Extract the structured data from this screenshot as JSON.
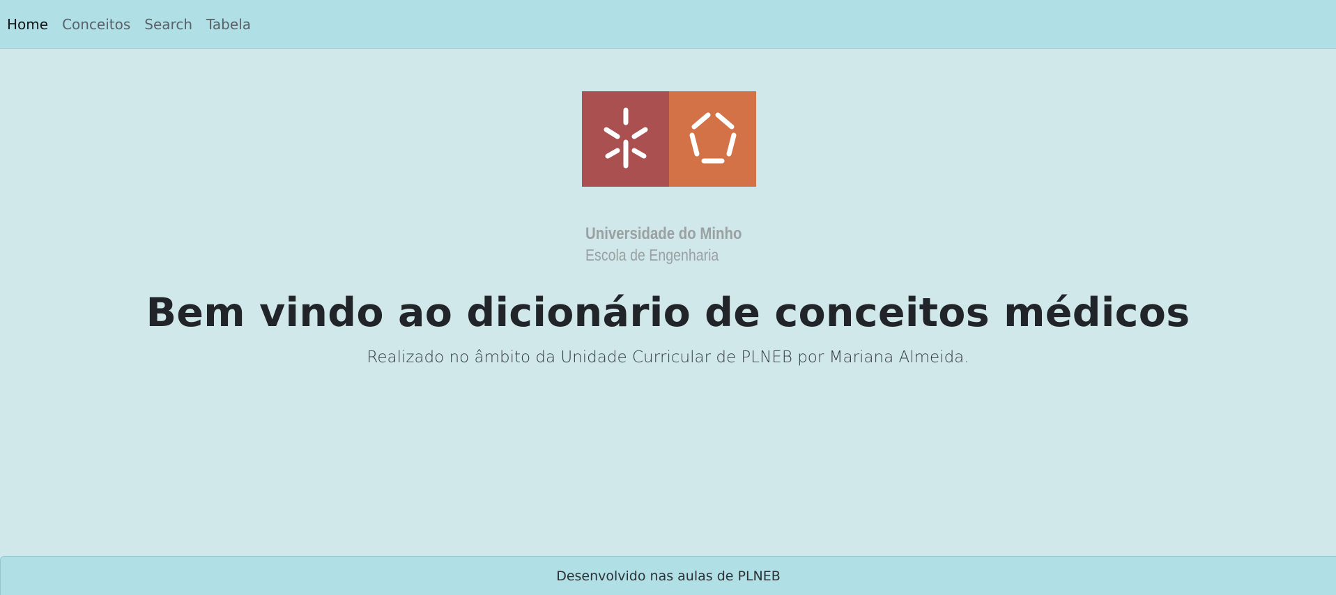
{
  "nav": {
    "items": [
      {
        "label": "Home",
        "active": true
      },
      {
        "label": "Conceitos",
        "active": false
      },
      {
        "label": "Search",
        "active": false
      },
      {
        "label": "Tabela",
        "active": false
      }
    ]
  },
  "logo": {
    "left_color": "#aa5050",
    "right_color": "#d37246",
    "left_icon": "asterisk-icon",
    "right_icon": "pentagon-icon",
    "university": "Universidade do Minho",
    "school": "Escola de Engenharia"
  },
  "main": {
    "title": "Bem vindo ao dicionário de conceitos médicos",
    "subtitle": "Realizado no âmbito da Unidade Curricular de PLNEB por Mariana Almeida."
  },
  "footer": {
    "text": "Desenvolvido nas aulas de PLNEB"
  },
  "colors": {
    "background": "#d0e8e9",
    "navbar": "#b0dfe5"
  }
}
